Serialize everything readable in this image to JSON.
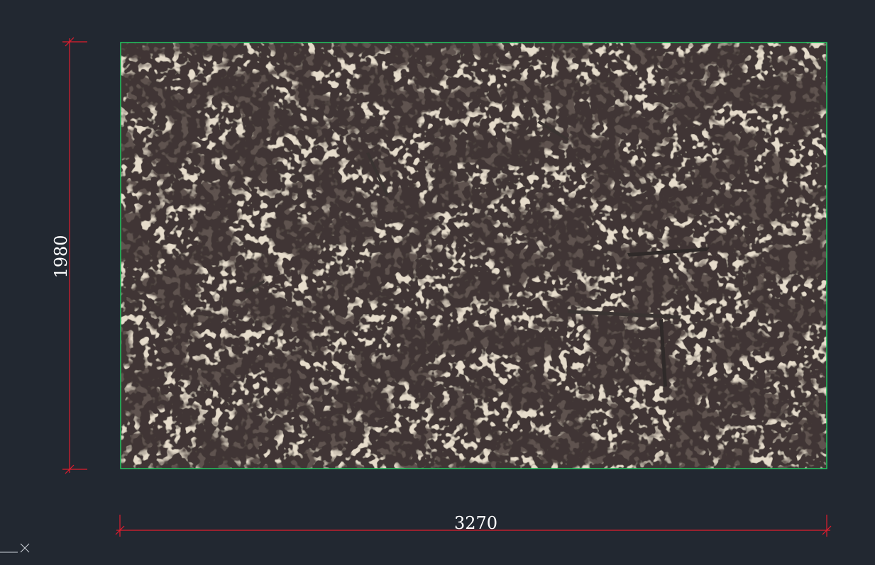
{
  "drawing": {
    "background_color": "#222831",
    "slab_border_color": "#22c55e",
    "dimension_color": "#e11d2e",
    "dimension_text_color": "#ffffff",
    "slab_material": "granite"
  },
  "dimensions": {
    "width_label": "3270",
    "height_label": "1980"
  },
  "icons": {
    "ucs": "ucs-axis-icon"
  }
}
